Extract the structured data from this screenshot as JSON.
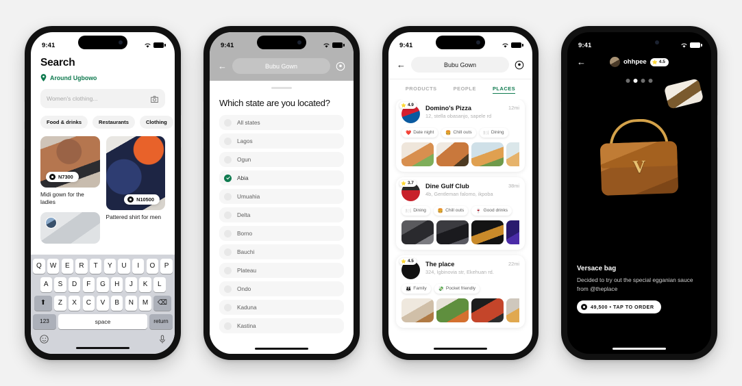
{
  "statusbar": {
    "time": "9:41",
    "wifi_icon": "wifi-icon",
    "battery_icon": "battery-icon"
  },
  "phone1": {
    "title": "Search",
    "location": {
      "icon": "location-pin-icon",
      "label": "Around Ugbowo"
    },
    "search": {
      "placeholder": "Women's clothing...",
      "icon": "camera-tag-icon"
    },
    "chips": [
      "Food & drinks",
      "Restaurants",
      "Clothing"
    ],
    "cards": [
      {
        "caption": "Midi gown for the ladies",
        "price": "N7300",
        "price_icon": "price-tag-icon"
      },
      {
        "caption": "Pattered shirt for men",
        "price": "N10500",
        "price_icon": "price-tag-icon"
      },
      {
        "caption": "",
        "price": "",
        "avatar": "user-avatar"
      }
    ],
    "keyboard": {
      "row1": [
        "Q",
        "W",
        "E",
        "R",
        "T",
        "Y",
        "U",
        "I",
        "O",
        "P"
      ],
      "row2": [
        "A",
        "S",
        "D",
        "F",
        "G",
        "H",
        "J",
        "K",
        "L"
      ],
      "row3": [
        "Z",
        "X",
        "C",
        "V",
        "B",
        "N",
        "M"
      ],
      "shift": "shift-icon",
      "backspace": "backspace-icon",
      "numbers": "123",
      "space": "space",
      "return": "return",
      "emoji": "emoji-icon",
      "mic": "microphone-icon"
    }
  },
  "phone2": {
    "nav": {
      "back_icon": "back-arrow-icon",
      "title": "Bubu Gown",
      "location_icon": "location-target-icon"
    },
    "sheet_title": "Which state are you located?",
    "options": [
      {
        "label": "All states",
        "selected": false
      },
      {
        "label": "Lagos",
        "selected": false
      },
      {
        "label": "Ogun",
        "selected": false
      },
      {
        "label": "Abia",
        "selected": true
      },
      {
        "label": "Umuahia",
        "selected": false
      },
      {
        "label": "Delta",
        "selected": false
      },
      {
        "label": "Borno",
        "selected": false
      },
      {
        "label": "Bauchi",
        "selected": false
      },
      {
        "label": "Plateau",
        "selected": false
      },
      {
        "label": "Ondo",
        "selected": false
      },
      {
        "label": "Kaduna",
        "selected": false
      },
      {
        "label": "Kastina",
        "selected": false
      }
    ],
    "selected_color": "#0f7a4f"
  },
  "phone3": {
    "nav": {
      "back_icon": "back-arrow-icon",
      "title": "Bubu Gown",
      "location_icon": "location-target-icon"
    },
    "tabs": [
      {
        "label": "PRODUCTS",
        "active": false
      },
      {
        "label": "PEOPLE",
        "active": false
      },
      {
        "label": "PLACES",
        "active": true
      }
    ],
    "active_tab_color": "#0f7a4f",
    "places": [
      {
        "name": "Domino's Pizza",
        "address": "12, stella obasanjo, sapele rd",
        "distance": "12mi",
        "rating": "4.9",
        "tags": [
          {
            "emoji": "❤️",
            "label": "Date night"
          },
          {
            "emoji": "🍔",
            "label": "Chill outs"
          },
          {
            "emoji": "🍽️",
            "label": "Dining"
          }
        ]
      },
      {
        "name": "Dine Gulf Club",
        "address": "4b, Gentleman falomo, ikpoba",
        "distance": "38mi",
        "rating": "3.7",
        "tags": [
          {
            "emoji": "🍽️",
            "label": "Dining"
          },
          {
            "emoji": "🍔",
            "label": "Chill outs"
          },
          {
            "emoji": "🍷",
            "label": "Good drinks"
          }
        ]
      },
      {
        "name": "The place",
        "address": "324, Igbinovia str, Ekehuan rd.",
        "distance": "22mi",
        "rating": "4.5",
        "tags": [
          {
            "emoji": "👪",
            "label": "Family"
          },
          {
            "emoji": "💸",
            "label": "Pocket friendly"
          }
        ]
      }
    ]
  },
  "phone4": {
    "nav": {
      "back_icon": "back-arrow-icon",
      "username": "ohhpee",
      "rating": "4.5",
      "avatar": "user-avatar"
    },
    "carousel": {
      "total_dots": 4,
      "active_index": 1
    },
    "title": "Versace bag",
    "description": "Decided to try out the special egganian sauce from @theplace",
    "order_button": {
      "icon": "price-tag-icon",
      "label": "49,500 • TAP TO ORDER"
    }
  }
}
